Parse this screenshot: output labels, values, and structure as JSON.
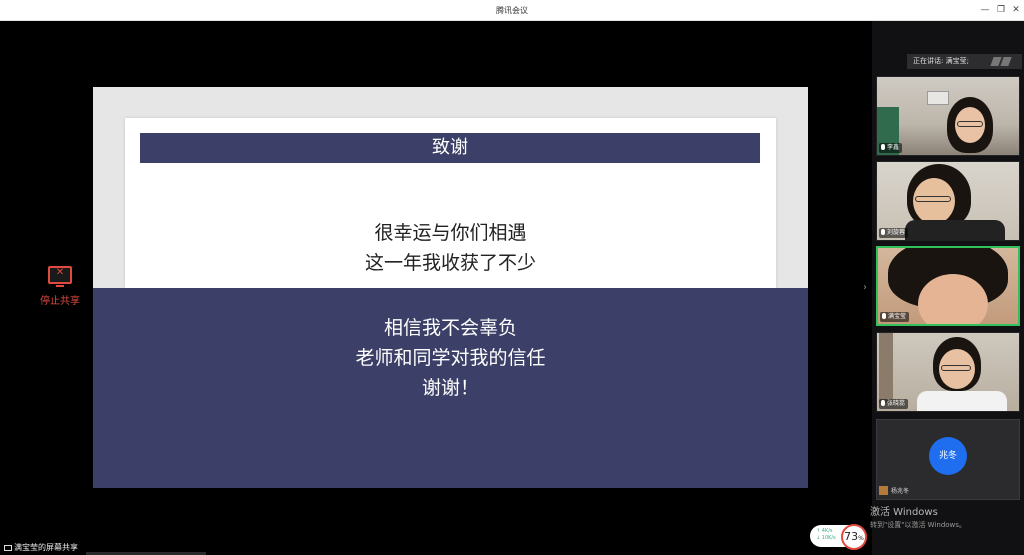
{
  "window": {
    "title": "腾讯会议",
    "controls": {
      "minimize": "—",
      "restore": "❐",
      "close": "✕"
    }
  },
  "stop_share": {
    "label": "停止共享",
    "icon": "stop-share-icon"
  },
  "slide": {
    "header": "致谢",
    "lines_top": [
      "很幸运与你们相遇",
      "这一年我收获了不少"
    ],
    "lines_bottom": [
      "相信我不会辜负",
      "老师和同学对我的信任",
      "谢谢！"
    ],
    "colors": {
      "band": "#3c4068",
      "paper": "#ffffff",
      "frame": "#e6e6e6"
    }
  },
  "sidebar": {
    "speaking_prefix": "正在讲话: 满宝莹;",
    "participants": [
      {
        "name": "李鑫"
      },
      {
        "name": "刘旋蓉"
      },
      {
        "name": "满宝莹"
      },
      {
        "name": "张晓蕊"
      },
      {
        "name": "杨兆冬",
        "avatar_text": "兆冬"
      }
    ],
    "active_color": "#33c15a"
  },
  "watermark": {
    "line1": "激活 Windows",
    "line2": "转到\"设置\"以激活 Windows。"
  },
  "network": {
    "up": "↑ 4K/s",
    "down": "↓ 10K/s",
    "value": "73",
    "unit": "%"
  },
  "share_status": {
    "label": "满宝莹的屏幕共享"
  }
}
